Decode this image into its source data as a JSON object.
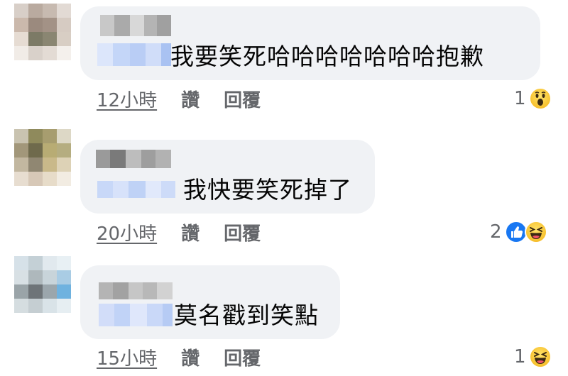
{
  "comments": [
    {
      "text": "我要笑死哈哈哈哈哈哈哈抱歉",
      "time": "12小時",
      "like_label": "讚",
      "reply_label": "回覆",
      "reaction_count": "1",
      "reactions": [
        "wow-icon"
      ]
    },
    {
      "text": "我快要笑死掉了",
      "time": "20小時",
      "like_label": "讚",
      "reply_label": "回覆",
      "reaction_count": "2",
      "reactions": [
        "like-icon",
        "laugh-icon"
      ]
    },
    {
      "text": "莫名戳到笑點",
      "time": "15小時",
      "like_label": "讚",
      "reply_label": "回覆",
      "reaction_count": "1",
      "reactions": [
        "laugh-icon"
      ]
    }
  ],
  "colors": {
    "bubble_bg": "#f0f2f5",
    "meta_text": "#65676b",
    "like_blue": "#1877f2",
    "emoji_yellow": "#f7c12e"
  }
}
